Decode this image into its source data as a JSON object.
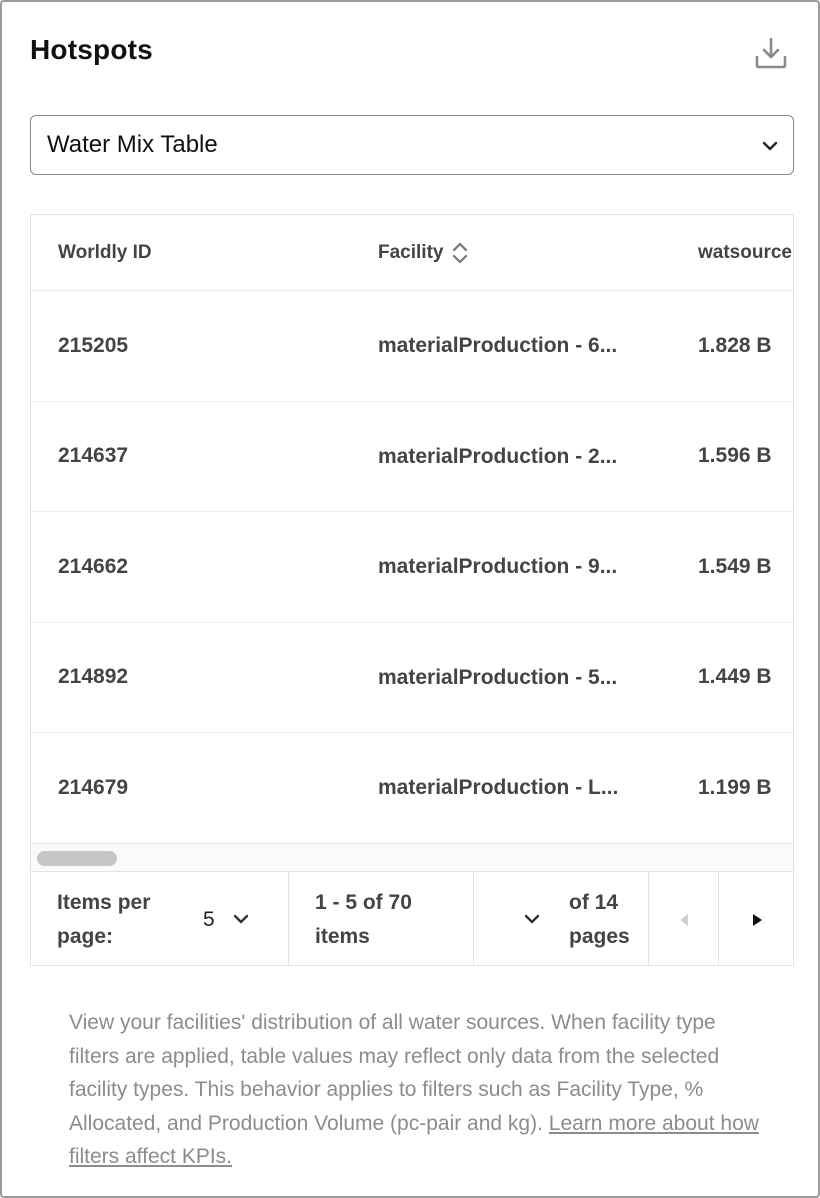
{
  "header": {
    "title": "Hotspots",
    "download_icon": "download-icon"
  },
  "view_select": {
    "value": "Water Mix Table",
    "icon": "chevron-down-icon"
  },
  "table": {
    "columns": [
      {
        "label": "Worldly ID"
      },
      {
        "label": "Facility",
        "sortable": true
      },
      {
        "label": "watsource"
      }
    ],
    "rows": [
      {
        "id": "215205",
        "facility": "materialProduction - 6...",
        "value": "1.828 B"
      },
      {
        "id": "214637",
        "facility": "materialProduction - 2...",
        "value": "1.596 B"
      },
      {
        "id": "214662",
        "facility": "materialProduction - 9...",
        "value": "1.549 B"
      },
      {
        "id": "214892",
        "facility": "materialProduction - 5...",
        "value": "1.449 B"
      },
      {
        "id": "214679",
        "facility": "materialProduction - L...",
        "value": "1.199 B"
      }
    ]
  },
  "pagination": {
    "items_per_page_label": "Items per page:",
    "items_per_page_value": "5",
    "range_label": "1 - 5 of 70 items",
    "pages_label": "of 14 pages",
    "prev_icon": "triangle-left-icon",
    "next_icon": "triangle-right-icon"
  },
  "description": {
    "text": "View your facilities' distribution of all water sources. When facility type filters are applied, table values may reflect only data from the selected facility types. This behavior applies to filters such as Facility Type, % Allocated, and Production Volume (pc-pair and kg). ",
    "link": "Learn more about how filters affect KPIs."
  },
  "colors": {
    "text_dark": "#111111",
    "text_table": "#444444",
    "text_muted": "#8c8c8c",
    "border": "#e4e4e4"
  }
}
